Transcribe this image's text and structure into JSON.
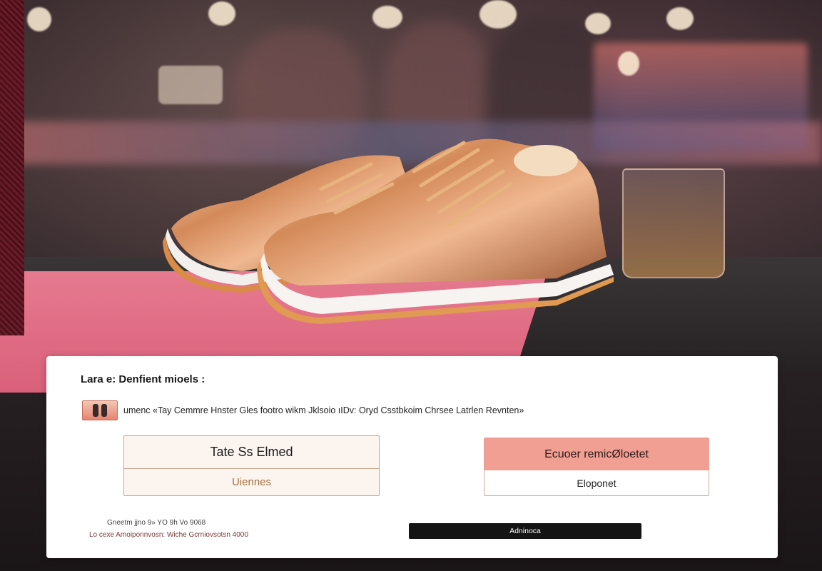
{
  "card": {
    "title": "Lara e: Denfient mioels :",
    "info_text": "umenc «Tay Cemmre Hnster Gles footro wikm Jklsoio ıIDv: Oryd Csstbkoim Chrsee Latrlen Revnten»",
    "options": [
      {
        "top_label": "Tate Ss Elmed",
        "bottom_label": "Uiennes"
      },
      {
        "top_label": "Ecuoer remicØloetet",
        "bottom_label": "Eloponet"
      }
    ],
    "footnote_1": "Gneetm jjno 9» YO 9h Vo 9068",
    "footnote_2": "Lo cexe Amoiponnvosn: Wiche Gcrniovsotsn 4000",
    "action_label": "Adninoca"
  },
  "colors": {
    "card_bg": "#ffffff",
    "option_left_bg": "#fbf4ef",
    "option_left_border": "#c9a58b",
    "option_right_header": "#f19e93",
    "action_button": "#141414",
    "accent_brown": "#a4713c"
  }
}
